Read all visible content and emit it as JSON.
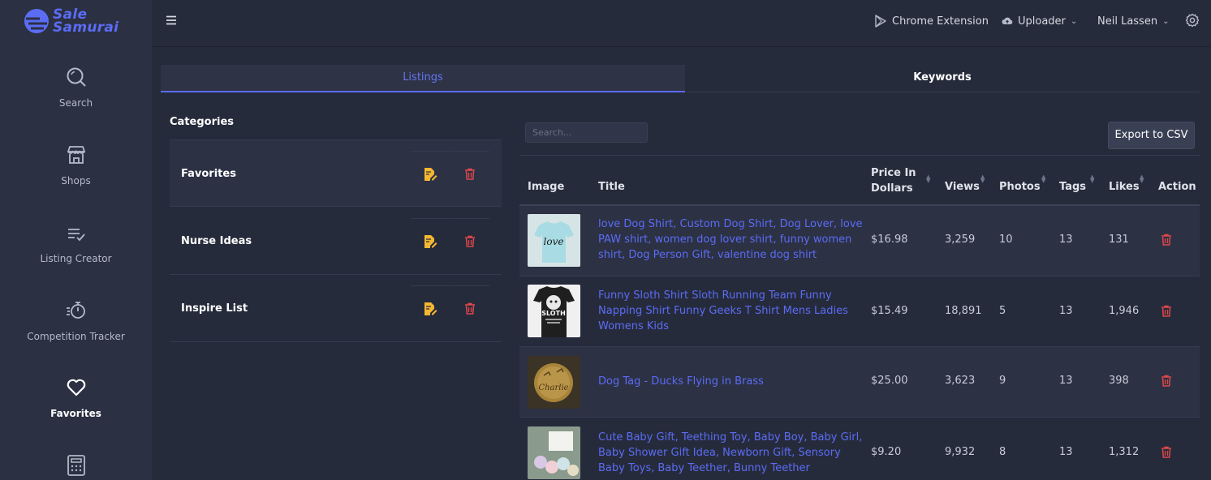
{
  "brand": {
    "line1": "Sale",
    "line2": "Samurai",
    "color": "#5b6cf5"
  },
  "sidebar": {
    "items": [
      {
        "label": "Search",
        "icon": "search-icon"
      },
      {
        "label": "Shops",
        "icon": "shop-icon"
      },
      {
        "label": "Listing Creator",
        "icon": "list-check-icon"
      },
      {
        "label": "Competition Tracker",
        "icon": "stopwatch-icon"
      },
      {
        "label": "Favorites",
        "icon": "heart-icon",
        "active": true
      },
      {
        "label": "",
        "icon": "calculator-icon"
      }
    ]
  },
  "topbar": {
    "chrome_extension": "Chrome Extension",
    "uploader": "Uploader",
    "user": "Neil Lassen"
  },
  "tabs": [
    {
      "label": "Listings",
      "active": true
    },
    {
      "label": "Keywords",
      "active": false
    }
  ],
  "categories": {
    "title": "Categories",
    "items": [
      {
        "name": "Favorites"
      },
      {
        "name": "Nurse Ideas"
      },
      {
        "name": "Inspire List"
      }
    ]
  },
  "table": {
    "search_placeholder": "Search...",
    "export_label": "Export to CSV",
    "headers": {
      "image": "Image",
      "title": "Title",
      "price_line1": "Price In",
      "price_line2": "Dollars",
      "views": "Views",
      "photos": "Photos",
      "tags": "Tags",
      "likes": "Likes",
      "action": "Action"
    },
    "rows": [
      {
        "title": "love Dog Shirt, Custom Dog Shirt, Dog Lover, love PAW shirt, women dog lover shirt, funny women shirt, Dog Person Gift, valentine dog shirt",
        "price": "$16.98",
        "views": "3,259",
        "photos": "10",
        "tags": "13",
        "likes": "131",
        "image_text": "love"
      },
      {
        "title": "Funny Sloth Shirt Sloth Running Team Funny Napping Shirt Funny Geeks T Shirt Mens Ladies Womens Kids",
        "price": "$15.49",
        "views": "18,891",
        "photos": "5",
        "tags": "13",
        "likes": "1,946",
        "image_text": "SLOTH"
      },
      {
        "title": "Dog Tag - Ducks Flying in Brass",
        "price": "$25.00",
        "views": "3,623",
        "photos": "9",
        "tags": "13",
        "likes": "398",
        "image_text": "Charlie"
      },
      {
        "title": "Cute Baby Gift, Teething Toy, Baby Boy, Baby Girl, Baby Shower Gift Idea, Newborn Gift, Sensory Baby Toys, Baby Teether, Bunny Teether",
        "price": "$9.20",
        "views": "9,932",
        "photos": "8",
        "tags": "13",
        "likes": "1,312",
        "image_text": ""
      }
    ]
  },
  "colors": {
    "accent": "#5b6cf5",
    "edit": "#f5b731",
    "delete": "#e0484b"
  }
}
